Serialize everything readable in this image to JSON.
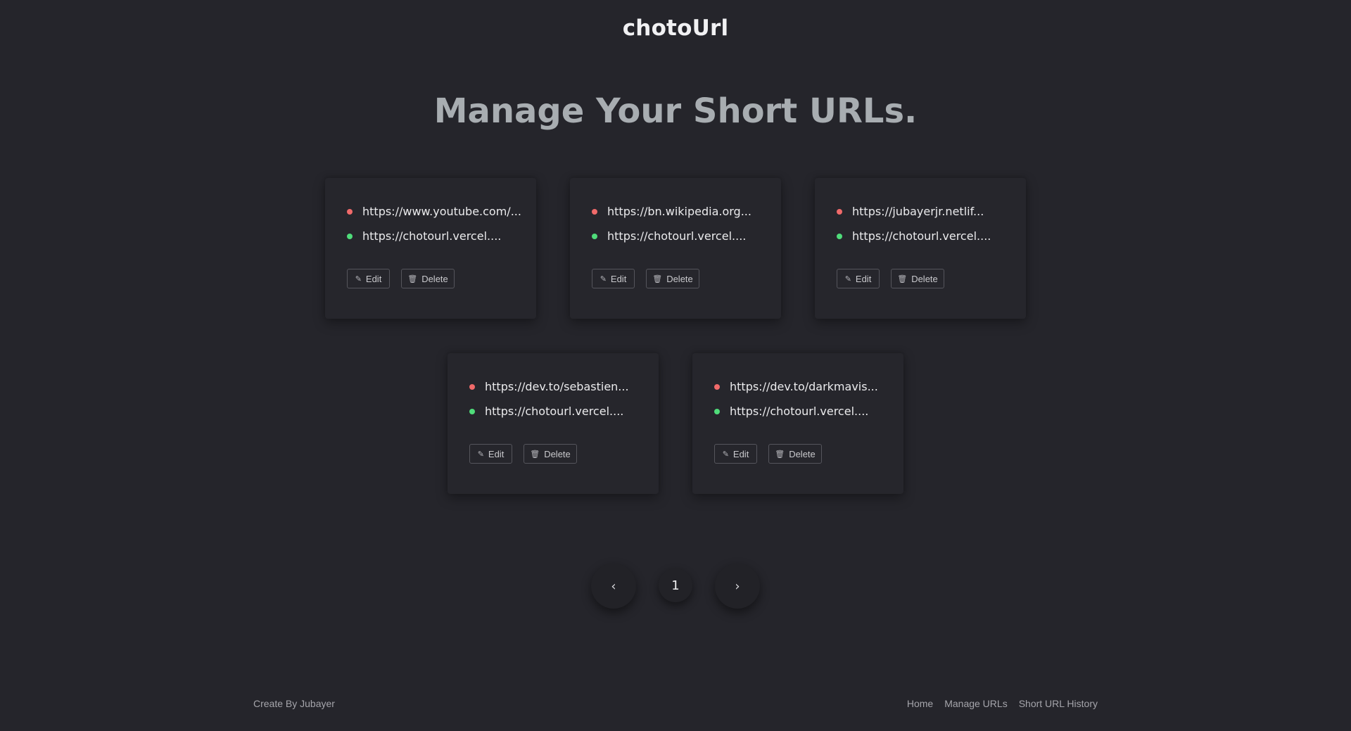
{
  "header": {
    "brand": "chotoUrl"
  },
  "main": {
    "title": "Manage Your Short URLs.",
    "cards": [
      {
        "original": "https://www.youtube.com/...",
        "short": "https://chotourl.vercel....",
        "edit_label": "Edit",
        "delete_label": "Delete"
      },
      {
        "original": "https://bn.wikipedia.org...",
        "short": "https://chotourl.vercel....",
        "edit_label": "Edit",
        "delete_label": "Delete"
      },
      {
        "original": "https://jubayerjr.netlif...",
        "short": "https://chotourl.vercel....",
        "edit_label": "Edit",
        "delete_label": "Delete"
      },
      {
        "original": "https://dev.to/sebastien...",
        "short": "https://chotourl.vercel....",
        "edit_label": "Edit",
        "delete_label": "Delete"
      },
      {
        "original": "https://dev.to/darkmavis...",
        "short": "https://chotourl.vercel....",
        "edit_label": "Edit",
        "delete_label": "Delete"
      }
    ]
  },
  "pagination": {
    "prev_icon": "chevron-left-icon",
    "next_icon": "chevron-right-icon",
    "current_page": "1"
  },
  "footer": {
    "credit": "Create By Jubayer",
    "links": [
      "Home",
      "Manage URLs",
      "Short URL History"
    ]
  },
  "colors": {
    "background": "#25252b",
    "original_dot": "#f06a6a",
    "short_dot": "#4fdc7a",
    "title": "#a8adb1"
  }
}
